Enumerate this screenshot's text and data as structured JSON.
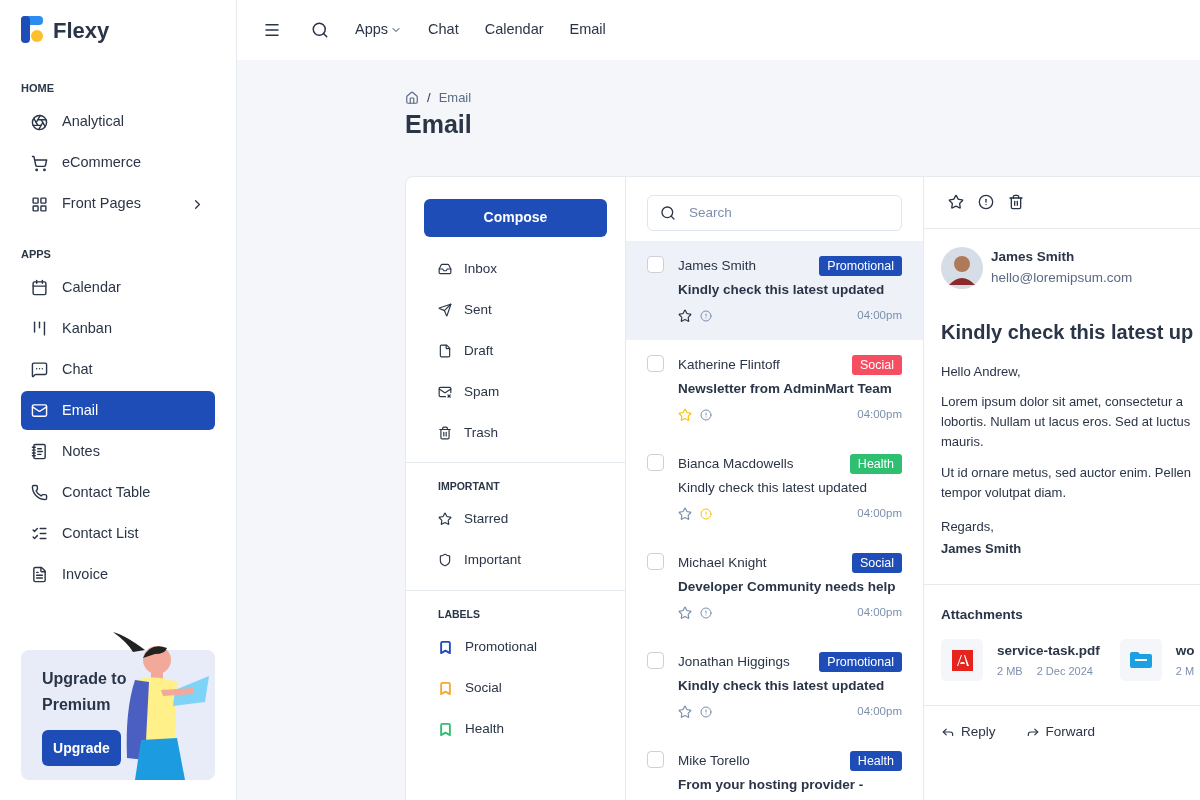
{
  "brand": {
    "name": "Flexy"
  },
  "sidebar": {
    "sections": [
      {
        "title": "HOME",
        "items": [
          {
            "label": "Analytical",
            "selected": false,
            "expandable": false
          },
          {
            "label": "eCommerce",
            "selected": false,
            "expandable": false
          },
          {
            "label": "Front Pages",
            "selected": false,
            "expandable": true
          }
        ]
      },
      {
        "title": "APPS",
        "items": [
          {
            "label": "Calendar",
            "selected": false,
            "expandable": false
          },
          {
            "label": "Kanban",
            "selected": false,
            "expandable": false
          },
          {
            "label": "Chat",
            "selected": false,
            "expandable": false
          },
          {
            "label": "Email",
            "selected": true,
            "expandable": false
          },
          {
            "label": "Notes",
            "selected": false,
            "expandable": false
          },
          {
            "label": "Contact Table",
            "selected": false,
            "expandable": false
          },
          {
            "label": "Contact List",
            "selected": false,
            "expandable": false
          },
          {
            "label": "Invoice",
            "selected": false,
            "expandable": false
          }
        ]
      }
    ],
    "promo": {
      "title": "Upgrade to Premium",
      "button": "Upgrade"
    }
  },
  "topbar": {
    "links": [
      {
        "label": "Apps",
        "dropdown": true
      },
      {
        "label": "Chat",
        "dropdown": false
      },
      {
        "label": "Calendar",
        "dropdown": false
      },
      {
        "label": "Email",
        "dropdown": false
      }
    ]
  },
  "breadcrumb": {
    "separator": "/",
    "current": "Email"
  },
  "page_title": "Email",
  "folders": {
    "compose": "Compose",
    "items": [
      {
        "label": "Inbox"
      },
      {
        "label": "Sent"
      },
      {
        "label": "Draft"
      },
      {
        "label": "Spam"
      },
      {
        "label": "Trash"
      }
    ],
    "important_title": "IMPORTANT",
    "important": [
      {
        "label": "Starred"
      },
      {
        "label": "Important"
      }
    ],
    "labels_title": "LABELS",
    "labels": [
      {
        "label": "Promotional",
        "color": "#1e4db7"
      },
      {
        "label": "Social",
        "color": "#f8a930"
      },
      {
        "label": "Health",
        "color": "#2fbf71"
      }
    ]
  },
  "search": {
    "placeholder": "Search"
  },
  "emails": [
    {
      "sender": "James Smith",
      "subject": "Kindly check this latest updated",
      "time": "04:00pm",
      "tag": "Promotional",
      "color": "#1e4db7",
      "selected": true,
      "unread": true,
      "starred": false,
      "important": false,
      "checked": false
    },
    {
      "sender": "Katherine Flintoff",
      "subject": "Newsletter from AdminMart Team",
      "time": "04:00pm",
      "tag": "Social",
      "color": "#f64e60",
      "selected": false,
      "unread": true,
      "starred": true,
      "important": false,
      "checked": false
    },
    {
      "sender": "Bianca Macdowells",
      "subject": "Kindly check this latest updated",
      "time": "04:00pm",
      "tag": "Health",
      "color": "#2fbf71",
      "selected": false,
      "unread": false,
      "starred": false,
      "important": true,
      "checked": false
    },
    {
      "sender": "Michael Knight",
      "subject": "Developer Community needs help",
      "time": "04:00pm",
      "tag": "Social",
      "color": "#1e4db7",
      "selected": false,
      "unread": true,
      "starred": false,
      "important": false,
      "checked": false
    },
    {
      "sender": "Jonathan Higgings",
      "subject": "Kindly check this latest updated",
      "time": "04:00pm",
      "tag": "Promotional",
      "color": "#1e4db7",
      "selected": false,
      "unread": true,
      "starred": false,
      "important": false,
      "checked": false
    },
    {
      "sender": "Mike Torello",
      "subject": "From your hosting provider -",
      "tag": "Health",
      "color": "#1e4db7",
      "selected": false,
      "unread": true,
      "checked": false
    }
  ],
  "detail": {
    "sender": "James Smith",
    "email": "hello@loremipsum.com",
    "subject": "Kindly check this latest up",
    "greeting": "Hello Andrew,",
    "paragraphs": [
      [
        "Lorem ipsum dolor sit amet, consectetur a",
        "lobortis. Nullam ut lacus eros. Sed at luctus",
        "mauris."
      ],
      [
        "Ut id ornare metus, sed auctor enim. Pellen",
        "tempor volutpat diam."
      ]
    ],
    "regards": "Regards,",
    "signature": "James Smith",
    "attachments_title": "Attachments",
    "attachments": [
      {
        "kind": "pdf",
        "name": "service-task.pdf",
        "size": "2 MB",
        "date": "2 Dec 2024"
      },
      {
        "kind": "zip",
        "name": "wo",
        "size": "2 M"
      }
    ],
    "actions": [
      {
        "label": "Reply"
      },
      {
        "label": "Forward"
      }
    ]
  }
}
